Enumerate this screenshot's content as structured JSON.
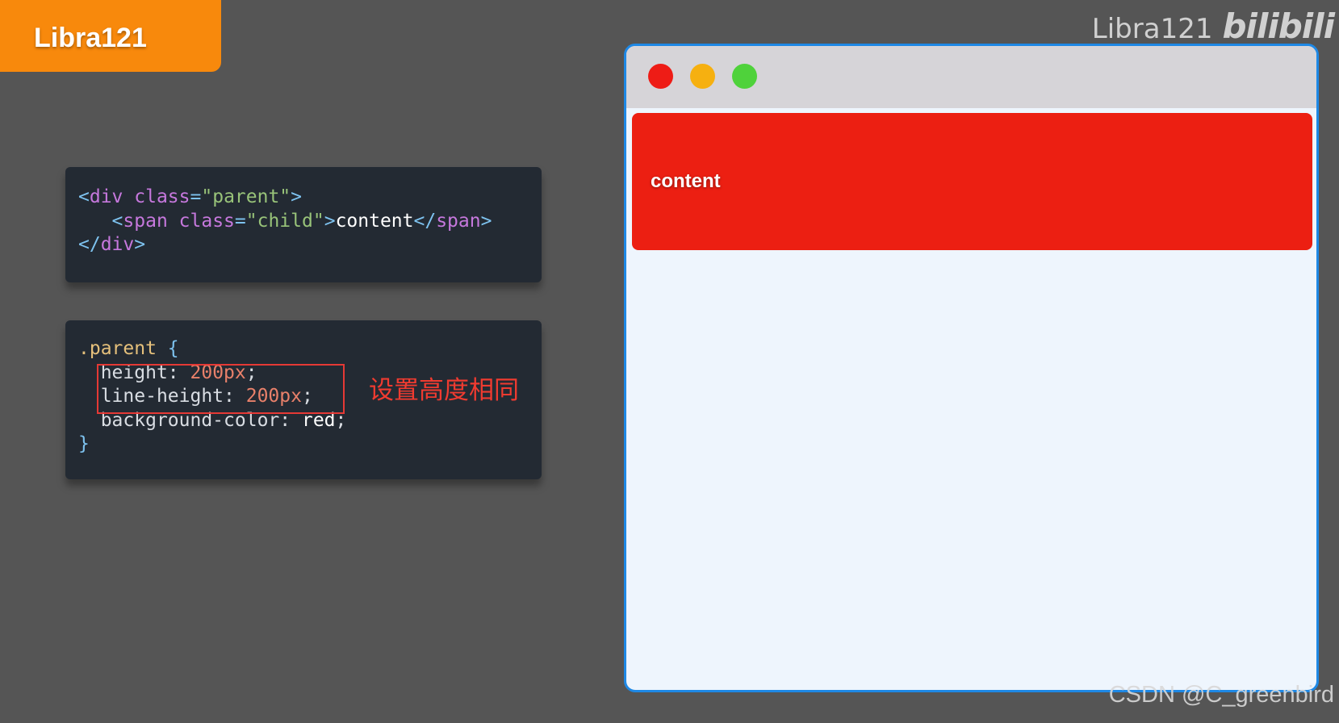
{
  "badge": {
    "label": "Libra121"
  },
  "watermark": {
    "channel": "Libra121",
    "platform": "bilibili"
  },
  "html_code": {
    "line1": {
      "open": "<",
      "tag": "div",
      "attr": "class",
      "eq": "=",
      "str": "\"parent\"",
      "close": ">"
    },
    "line2": {
      "indent": "   ",
      "open": "<",
      "tag": "span",
      "attr": "class",
      "eq": "=",
      "str": "\"child\"",
      "close": ">",
      "text": "content",
      "end_open": "</",
      "end_tag": "span",
      "end_close": ">"
    },
    "line3": {
      "end_open": "</",
      "tag": "div",
      "close": ">"
    }
  },
  "css_code": {
    "selector": ".parent",
    "open_brace": "{",
    "rules": [
      {
        "prop": "height",
        "colon": ": ",
        "value": "200px",
        "semi": ";"
      },
      {
        "prop": "line-height",
        "colon": ": ",
        "value": "200px",
        "semi": ";"
      },
      {
        "prop": "background-color",
        "colon": ": ",
        "value": "red",
        "semi": ";"
      }
    ],
    "close_brace": "}"
  },
  "annotation": "设置高度相同",
  "browser_preview": {
    "content_text": "content",
    "colors": {
      "close": "#ee1c16",
      "minimize": "#f6b010",
      "maximize": "#4fd23b",
      "parent_background": "#ec1f12",
      "frame": "#1e88e5"
    }
  },
  "credit": "CSDN @C_greenbird"
}
